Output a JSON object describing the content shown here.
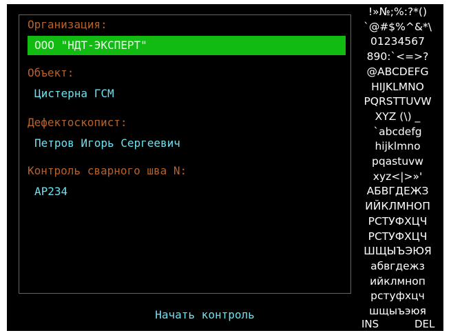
{
  "form": {
    "organization_label": "Организация:",
    "organization_value": "ООО \"НДТ-ЭКСПЕРТ\"",
    "object_label": "Объект:",
    "object_value": "Цистерна ГСМ",
    "inspector_label": "Дефектоскопист:",
    "inspector_value": "Петров Игорь Сергеевич",
    "weld_label": "Контроль сварного шва N:",
    "weld_value": "AP234"
  },
  "start_button_label": "Начать контроль",
  "charset": {
    "rows": [
      "!»№;%:?*()",
      "`@#$%^&*\\",
      "01234567",
      "890:`<=>?",
      "@ABCDEFG",
      "HIJKLMNO",
      "PQRSTTUVW",
      "XYZ (\\) _",
      "`abcdefg",
      "hijklmno",
      "pqastuvw",
      "xyz<|>»'",
      "АБВГДЕЖЗ",
      "ИЙКЛМНОП",
      "РСТУФХЦЧ",
      "РСТУФХЦЧ",
      "ШЩЫЪЭЮЯ",
      "абвгдежз",
      "ийклмноп",
      "рстуфхцч",
      "шщыъэюя"
    ],
    "ins_label": "INS",
    "del_label": "DEL"
  },
  "colors": {
    "background": "#000000",
    "label": "#b8622b",
    "value": "#6fe0ee",
    "selected_field": "#12bb12",
    "frame_border": "#a0522d"
  }
}
